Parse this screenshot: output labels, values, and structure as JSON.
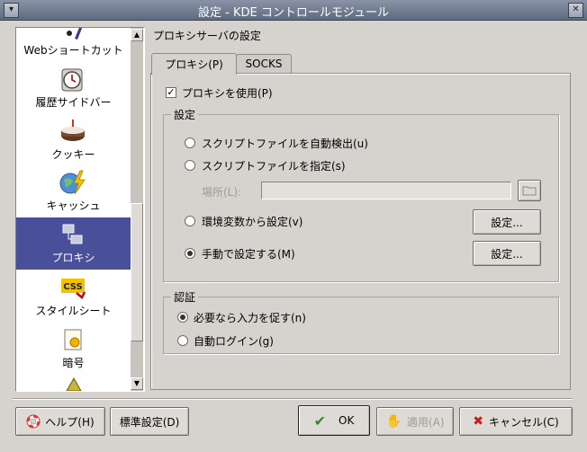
{
  "window": {
    "title": "設定 - KDE コントロールモジュール"
  },
  "sidebar": {
    "items": [
      {
        "label": "Webショートカット",
        "icon": "web-shortcut-icon"
      },
      {
        "label": "履歴サイドバー",
        "icon": "clock-icon"
      },
      {
        "label": "クッキー",
        "icon": "cookie-cake-icon"
      },
      {
        "label": "キャッシュ",
        "icon": "cache-icon"
      },
      {
        "label": "プロキシ",
        "icon": "proxy-icon",
        "selected": true
      },
      {
        "label": "スタイルシート",
        "icon": "css-icon"
      },
      {
        "label": "暗号",
        "icon": "crypto-icon"
      }
    ]
  },
  "panel": {
    "title": "プロキシサーバの設定",
    "tabs": [
      {
        "label": "プロキシ(P)",
        "active": true
      },
      {
        "label": "SOCKS",
        "active": false
      }
    ],
    "use_proxy": {
      "label": "プロキシを使用(P)",
      "checked": true
    },
    "settings_group": {
      "title": "設定",
      "auto_detect": "スクリプトファイルを自動検出(u)",
      "specify_script": "スクリプトファイルを指定(s)",
      "location_label": "場所(L):",
      "location_value": "",
      "env_vars": "環境変数から設定(v)",
      "manual": "手動で設定する(M)",
      "setup_button": "設定...",
      "selected": "manual"
    },
    "auth_group": {
      "title": "認証",
      "prompt": "必要なら入力を促す(n)",
      "auto_login": "自動ログイン(g)",
      "selected": "prompt"
    }
  },
  "footer": {
    "help": "ヘルプ(H)",
    "defaults": "標準設定(D)",
    "ok": "OK",
    "apply": "適用(A)",
    "cancel": "キャンセル(C)"
  },
  "colors": {
    "selection": "#4a4f9a",
    "titlebar": "#6b7589",
    "window_bg": "#d6d3ce"
  }
}
